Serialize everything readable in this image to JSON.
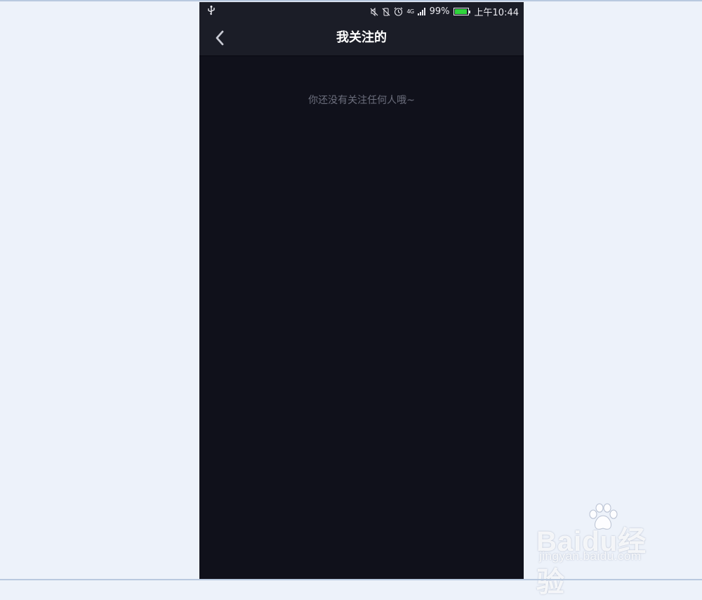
{
  "status_bar": {
    "network_label": "4G",
    "battery_percent_text": "99%",
    "battery_level": 0.99,
    "time": "上午10:44",
    "battery_color": "#2fd43c",
    "icons": [
      "usb-icon",
      "mute-icon",
      "vibrate-off-icon",
      "alarm-icon",
      "signal-icon",
      "battery-icon"
    ]
  },
  "header": {
    "title": "我关注的",
    "back_icon": "chevron-left-icon"
  },
  "main": {
    "empty_message": "你还没有关注任何人哦~"
  },
  "watermark": {
    "brand": "Baidu经验",
    "url": "jingyan.baidu.com"
  },
  "colors": {
    "page_bg": "#10111b",
    "bar_bg": "#1b1d27",
    "outer_bg": "#edf2fa"
  }
}
